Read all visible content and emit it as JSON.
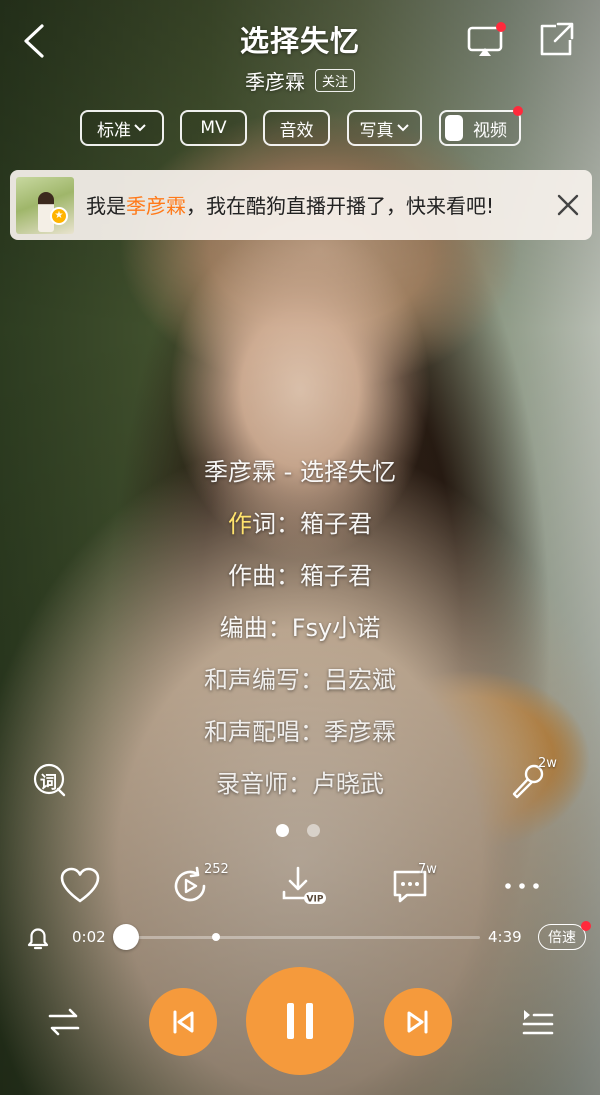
{
  "header": {
    "title": "选择失忆",
    "artist": "季彦霖",
    "follow_label": "关注"
  },
  "chips": {
    "quality": "标准",
    "mv": "MV",
    "effects": "音效",
    "photo": "写真",
    "video": "视频"
  },
  "banner": {
    "prefix": "我是",
    "name": "季彦霖",
    "suffix": "，我在酷狗直播开播了，快来看吧!"
  },
  "lyrics": {
    "lines": [
      "季彦霖 - 选择失忆",
      "作词：箱子君",
      "作曲：箱子君",
      "编曲：Fsy小诺",
      "和声编写：吕宏斌",
      "和声配唱：季彦霖",
      "录音师：卢晓武"
    ],
    "current_sung": "作"
  },
  "side_buttons": {
    "lyrics_icon_text": "词",
    "mic_count": "2w"
  },
  "actions": {
    "loop_count": "252",
    "comment_count": "7w"
  },
  "progress": {
    "current": "0:02",
    "total": "4:39",
    "speed_label": "倍速",
    "fraction": 0.007
  },
  "colors": {
    "accent": "#f59a3c",
    "badge": "#ff2a3c",
    "highlight": "#ff7a1a",
    "lyric_sung": "#ffe36d"
  }
}
